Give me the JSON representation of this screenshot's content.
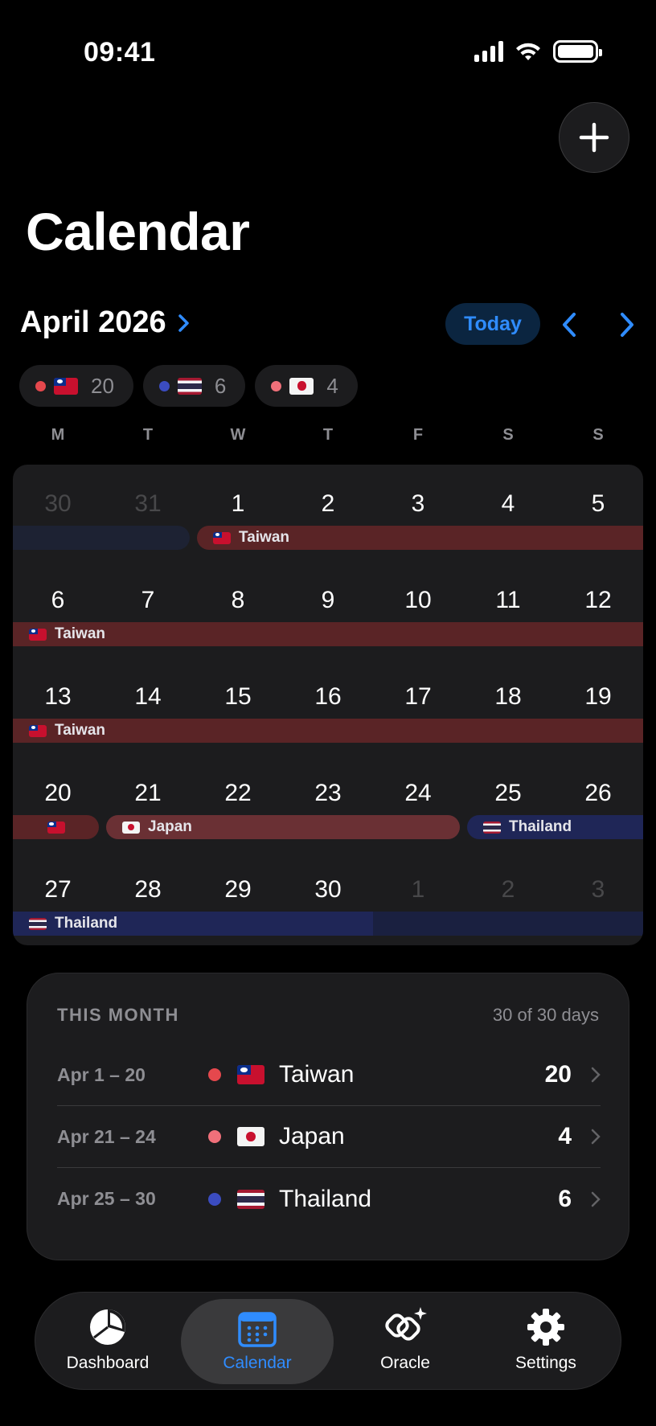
{
  "status": {
    "time": "09:41"
  },
  "header": {
    "title": "Calendar"
  },
  "month": {
    "label": "April 2026",
    "today_label": "Today"
  },
  "chips": [
    {
      "country": "Taiwan",
      "count": "20",
      "color": "#e5484d"
    },
    {
      "country": "Thailand",
      "count": "6",
      "color": "#3b4cc0"
    },
    {
      "country": "Japan",
      "count": "4",
      "color": "#f0707a"
    }
  ],
  "weekdays": [
    "M",
    "T",
    "W",
    "T",
    "F",
    "S",
    "S"
  ],
  "calendar": {
    "weeks": [
      [
        "30",
        "31",
        "1",
        "2",
        "3",
        "4",
        "5"
      ],
      [
        "6",
        "7",
        "8",
        "9",
        "10",
        "11",
        "12"
      ],
      [
        "13",
        "14",
        "15",
        "16",
        "17",
        "18",
        "19"
      ],
      [
        "20",
        "21",
        "22",
        "23",
        "24",
        "25",
        "26"
      ],
      [
        "27",
        "28",
        "29",
        "30",
        "1",
        "2",
        "3"
      ]
    ],
    "bar_labels": {
      "taiwan": "Taiwan",
      "japan": "Japan",
      "thailand": "Thailand"
    }
  },
  "summary": {
    "heading": "THIS MONTH",
    "days_text": "30 of 30 days",
    "rows": [
      {
        "range": "Apr 1 – 20",
        "country": "Taiwan",
        "count": "20",
        "color": "#e5484d"
      },
      {
        "range": "Apr 21 – 24",
        "country": "Japan",
        "count": "4",
        "color": "#f0707a"
      },
      {
        "range": "Apr 25 – 30",
        "country": "Thailand",
        "count": "6",
        "color": "#3b4cc0"
      }
    ]
  },
  "tabs": [
    {
      "label": "Dashboard",
      "icon": "pie-chart-icon"
    },
    {
      "label": "Calendar",
      "icon": "calendar-icon",
      "active": true
    },
    {
      "label": "Oracle",
      "icon": "oracle-sparkle-icon"
    },
    {
      "label": "Settings",
      "icon": "gear-icon"
    }
  ],
  "colors": {
    "accent": "#2f8cff",
    "taiwan": "#e5484d",
    "japan": "#f0707a",
    "thailand": "#3b4cc0"
  }
}
